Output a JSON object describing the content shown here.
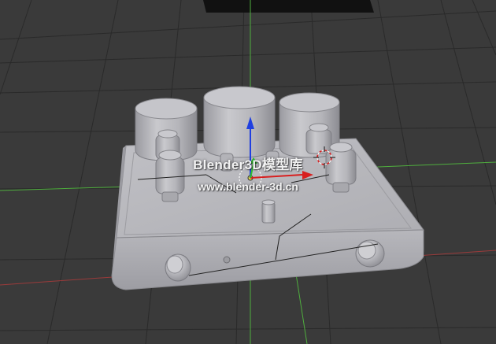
{
  "viewport": {
    "background": "#3a3a3a",
    "grid_color": "#2a2a2a",
    "axis_x_color": "#9b3a3a",
    "axis_y_color": "#4fae3e",
    "model_color": "#b4b4b8"
  },
  "watermark": {
    "title": "Blender3D模型库",
    "url": "www.blender-3d.cn"
  },
  "gizmo": {
    "z_color": "#1f3fe0",
    "x_color": "#d81f1f",
    "y_color": "#2fbf2f"
  }
}
